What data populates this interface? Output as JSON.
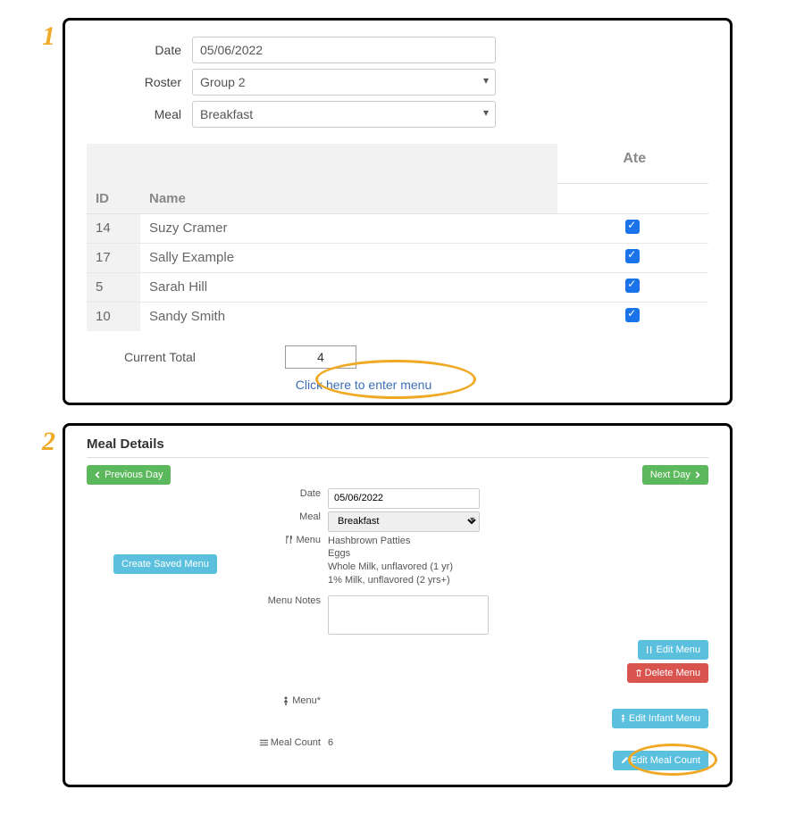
{
  "step1_num": "1",
  "step2_num": "2",
  "panel1": {
    "date_label": "Date",
    "date_value": "05/06/2022",
    "roster_label": "Roster",
    "roster_value": "Group 2",
    "meal_label": "Meal",
    "meal_value": "Breakfast",
    "col_id": "ID",
    "col_name": "Name",
    "col_ate": "Ate",
    "rows": [
      {
        "id": "14",
        "name": "Suzy Cramer",
        "ate": true
      },
      {
        "id": "17",
        "name": "Sally Example",
        "ate": true
      },
      {
        "id": "5",
        "name": "Sarah Hill",
        "ate": true
      },
      {
        "id": "10",
        "name": "Sandy Smith",
        "ate": true
      }
    ],
    "total_label": "Current Total",
    "total_value": "4",
    "enter_menu_link": "Click here to enter menu"
  },
  "panel2": {
    "title": "Meal Details",
    "prev_day": "Previous Day",
    "next_day": "Next Day",
    "date_label": "Date",
    "date_value": "05/06/2022",
    "meal_label": "Meal",
    "meal_value": "Breakfast",
    "menu_label": "Menu",
    "menu_items": [
      "Hashbrown Patties",
      "Eggs",
      "Whole Milk, unflavored (1 yr)",
      "1% Milk, unflavored (2 yrs+)"
    ],
    "create_saved_menu": "Create Saved Menu",
    "notes_label": "Menu Notes",
    "edit_menu": "Edit Menu",
    "delete_menu": "Delete Menu",
    "infant_menu_label": "Menu*",
    "edit_infant_menu": "Edit Infant Menu",
    "meal_count_label": "Meal Count",
    "meal_count_value": "6",
    "edit_meal_count": "Edit Meal Count"
  }
}
